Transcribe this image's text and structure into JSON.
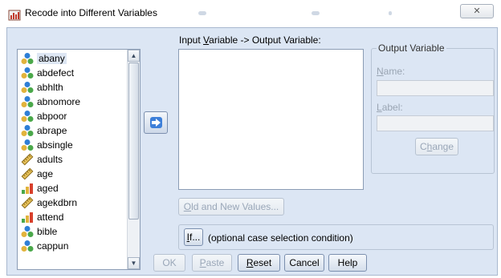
{
  "window": {
    "title": "Recode into Different Variables",
    "close_glyph": "✕"
  },
  "variables": [
    {
      "name": "abany",
      "icon": "nominal-icon",
      "selected": true
    },
    {
      "name": "abdefect",
      "icon": "nominal-icon"
    },
    {
      "name": "abhlth",
      "icon": "nominal-icon"
    },
    {
      "name": "abnomore",
      "icon": "nominal-icon"
    },
    {
      "name": "abpoor",
      "icon": "nominal-icon"
    },
    {
      "name": "abrape",
      "icon": "nominal-icon"
    },
    {
      "name": "absingle",
      "icon": "nominal-icon"
    },
    {
      "name": "adults",
      "icon": "scale-icon"
    },
    {
      "name": "age",
      "icon": "scale-icon"
    },
    {
      "name": "aged",
      "icon": "ordinal-icon"
    },
    {
      "name": "agekdbrn",
      "icon": "scale-icon"
    },
    {
      "name": "attend",
      "icon": "ordinal-icon"
    },
    {
      "name": "bible",
      "icon": "nominal-icon"
    },
    {
      "name": "cappun",
      "icon": "nominal-icon"
    }
  ],
  "io": {
    "label_pre": "Input ",
    "label_mnemonic": "V",
    "label_post": "ariable -> Output Variable:"
  },
  "output": {
    "group_title": "Output Variable",
    "name_mnemonic": "N",
    "name_rest": "ame:",
    "label_mnemonic": "L",
    "label_rest": "abel:",
    "change_pre": "C",
    "change_mnemonic": "h",
    "change_post": "ange"
  },
  "old_new": {
    "mnemonic": "O",
    "rest": "ld and New Values..."
  },
  "if_row": {
    "button_mnemonic": "I",
    "button_rest": "f...",
    "text": "(optional case selection condition)"
  },
  "buttons": {
    "ok": "OK",
    "paste_mnemonic": "P",
    "paste_rest": "aste",
    "reset_mnemonic": "R",
    "reset_rest": "eset",
    "cancel": "Cancel",
    "help": "Help"
  },
  "colors": {
    "dialog_bg": "#dce6f4",
    "arrow_blue": "#3d7fd9",
    "disabled_text": "#9aa7b8"
  }
}
